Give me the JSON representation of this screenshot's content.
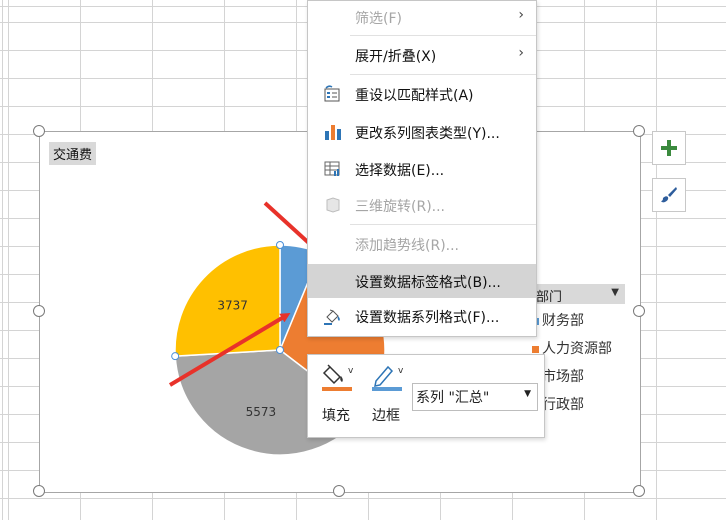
{
  "context_menu": {
    "items": [
      {
        "label": "筛选(F)",
        "disabled": true,
        "submenu": true,
        "icon": ""
      },
      {
        "label": "展开/折叠(X)",
        "disabled": false,
        "submenu": true,
        "icon": ""
      },
      {
        "label": "重设以匹配样式(A)",
        "disabled": false,
        "submenu": false,
        "icon": "reset-style-icon"
      },
      {
        "label": "更改系列图表类型(Y)...",
        "disabled": false,
        "submenu": false,
        "icon": "change-chart-type-icon"
      },
      {
        "label": "选择数据(E)...",
        "disabled": false,
        "submenu": false,
        "icon": "select-data-icon"
      },
      {
        "label": "三维旋转(R)...",
        "disabled": true,
        "submenu": false,
        "icon": "3d-rotation-icon"
      },
      {
        "label": "添加趋势线(R)...",
        "disabled": true,
        "submenu": false,
        "icon": ""
      },
      {
        "label": "设置数据标签格式(B)...",
        "disabled": false,
        "submenu": false,
        "icon": "",
        "highlighted": true
      },
      {
        "label": "设置数据系列格式(F)...",
        "disabled": false,
        "submenu": false,
        "icon": "format-series-icon"
      }
    ]
  },
  "mini_toolbar": {
    "fill_label": "填充",
    "border_label": "边框",
    "series_value": "系列 \"汇总\""
  },
  "chart": {
    "field_button": "交通费",
    "legend_header": "部门",
    "legend": [
      {
        "label": "财务部",
        "color": "#5b9bd5"
      },
      {
        "label": "人力资源部",
        "color": "#ed7d31"
      },
      {
        "label": "市场部",
        "color": "#a5a5a5"
      },
      {
        "label": "行政部",
        "color": "#ffc000"
      }
    ]
  },
  "chart_data": {
    "type": "pie",
    "categories": [
      "财务部",
      "人力资源部",
      "市场部",
      "行政部"
    ],
    "values": [
      900,
      4200,
      5573,
      3737
    ],
    "data_labels": [
      "",
      "",
      "5573",
      "3737"
    ],
    "colors": [
      "#5b9bd5",
      "#ed7d31",
      "#a5a5a5",
      "#ffc000"
    ],
    "title": "",
    "legend_position": "right"
  }
}
